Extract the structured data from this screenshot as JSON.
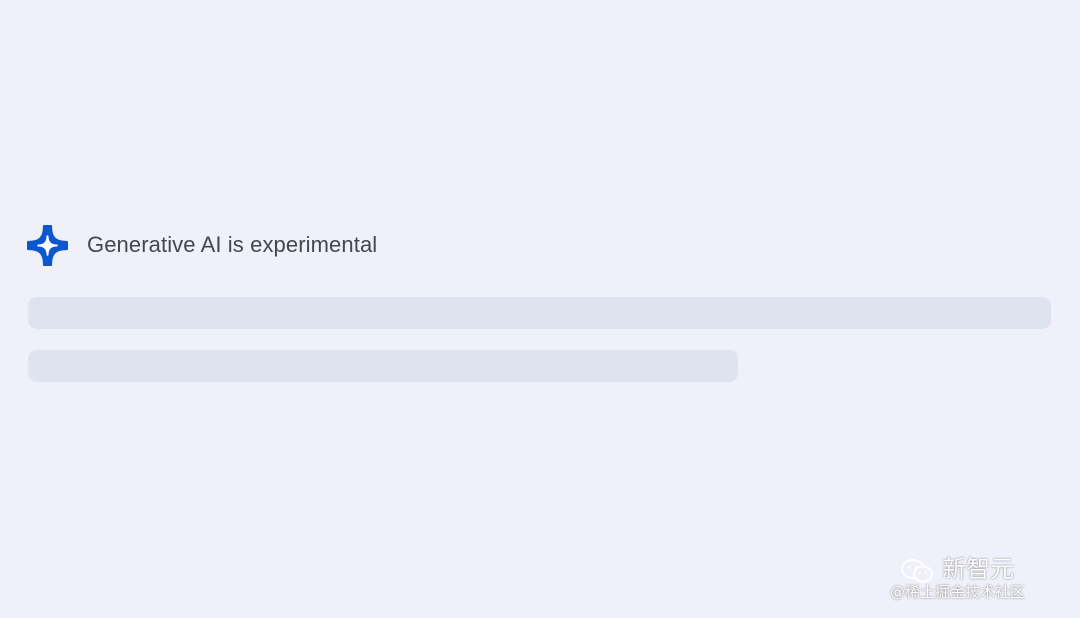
{
  "notice": {
    "icon": "sparkle-icon",
    "icon_color": "#0b57d0",
    "title": "Generative AI is experimental"
  },
  "loading": {
    "placeholder_color": "#dfe2ef"
  },
  "watermark": {
    "icon": "wechat-icon",
    "brand": "新智元",
    "handle": "@稀土掘金技术社区"
  }
}
